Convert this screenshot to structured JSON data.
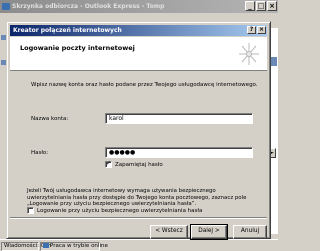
{
  "background_window": {
    "title": "Skrzynka odbiorcza - Outlook Express - Tomp",
    "controls": [
      "_",
      "□",
      "×"
    ],
    "right_pane_label": "np",
    "right_pane_arrow": "►",
    "status_messages": "Wiadomości: 0, n",
    "status_online": "Praca w trybie online"
  },
  "dialog": {
    "title": "Kreator połączeń internetowych",
    "help_label": "?",
    "close_label": "×",
    "header_title": "Logowanie poczty internetowej",
    "intro_text": "Wpisz nazwę konta oraz hasło podane przez Twojego usługodawcę internetowego.",
    "account_label": "Nazwa konta:",
    "account_value": "karol",
    "password_label": "Hasło:",
    "password_value": "●●●●●",
    "remember_password": {
      "label": "Zapamiętaj hasło",
      "checked": true,
      "mark": "✓"
    },
    "spa_info": "Jeżeli Twój usługodawca internetowy wymaga używania bezpiecznego uwierzytelniania hasła przy dostępie do Twojego konta pocztowego, zaznacz pole „Logowanie przy użyciu bezpiecznego uwierzytelniania hasła”.",
    "spa_checkbox": {
      "label": "Logowanie przy użyciu bezpiecznego uwierzytelniania hasła",
      "checked": false,
      "mark": ""
    },
    "buttons": {
      "back": "< Wstecz",
      "next": "Dalej >",
      "cancel": "Anuluj"
    }
  },
  "colors": {
    "titlebar_active": "#0a246a",
    "titlebar_inactive": "#8c8c8c",
    "face": "#d4d0c8"
  },
  "icons": [
    "outlook-express-icon",
    "wizard-sparkle-icon"
  ]
}
